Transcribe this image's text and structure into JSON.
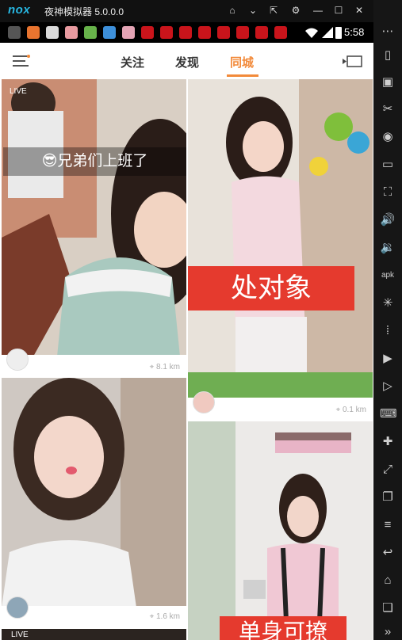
{
  "emulator": {
    "brand": "nox",
    "title": "夜神模拟器 5.0.0.0",
    "window_controls": [
      "home-icon",
      "chevron-down-icon",
      "pin-icon",
      "gear-icon",
      "minimize-icon",
      "maximize-icon",
      "close-icon"
    ],
    "toolbar_icons": [
      "more-icon",
      "phone-icon",
      "robot-icon",
      "scissors-icon",
      "location-icon",
      "screen-icon",
      "fullscreen-icon",
      "volume-up-icon",
      "volume-down-icon",
      "apk-icon",
      "loading-icon",
      "shake-icon",
      "video-icon",
      "play-icon",
      "keyboard-icon",
      "gamepad-icon",
      "multi-window-icon",
      "copy-icon",
      "menu-icon",
      "back-icon",
      "home-icon",
      "recent-apps-icon",
      "more-down-icon"
    ]
  },
  "status_bar": {
    "time": "5:58"
  },
  "header": {
    "tabs": [
      {
        "label": "关注"
      },
      {
        "label": "发现"
      },
      {
        "label": "同城",
        "active": true
      }
    ]
  },
  "feed": {
    "cards": [
      {
        "badge": "LIVE",
        "caption": "兄弟们上班了",
        "caption_emoji": "😎",
        "distance": "8.1 km"
      },
      {
        "caption": "处对象",
        "distance": "0.1 km"
      },
      {
        "distance": "1.6 km"
      },
      {
        "caption": "单身可撩"
      },
      {
        "badge": "LIVE"
      }
    ]
  },
  "colors": {
    "accent": "#f28a3a",
    "nox_blue": "#27b8e3",
    "caption_red": "#e53a2e"
  }
}
